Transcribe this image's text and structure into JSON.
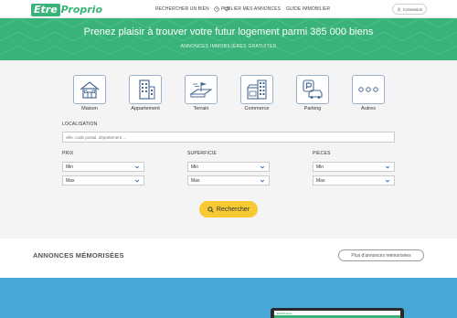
{
  "header": {
    "logo_part1": "Etre",
    "logo_part2": "Proprio",
    "nav_search": "RECHERCHER UN BIEN",
    "nav_publish": "PUBLIER MES ANNONCES",
    "nav_guide": "GUIDE IMMOBILIER",
    "login": "Connexion"
  },
  "hero": {
    "title": "Prenez plaisir à trouver votre futur logement parmi 385 000 biens",
    "subtitle": "ANNONCES IMMOBILIÈRES GRATUITES"
  },
  "property_types": [
    {
      "label": "Maison",
      "icon": "house-icon"
    },
    {
      "label": "Appartement",
      "icon": "apartment-building-icon"
    },
    {
      "label": "Terrain",
      "icon": "land-plot-icon"
    },
    {
      "label": "Commerce",
      "icon": "store-icon"
    },
    {
      "label": "Parking",
      "icon": "parking-icon"
    },
    {
      "label": "Autres",
      "icon": "more-dots-icon"
    }
  ],
  "location": {
    "label": "LOCALISATION",
    "placeholder": "ville, code postal, département ..."
  },
  "filters": {
    "price": {
      "label": "PRIX",
      "min": "Min",
      "max": "Max"
    },
    "surface": {
      "label": "SUPERFICIE",
      "min": "Min",
      "max": "Max"
    },
    "rooms": {
      "label": "PIECES",
      "min": "Min",
      "max": "Max"
    }
  },
  "search_button": "Rechercher",
  "memorised": {
    "title": "ANNONCES MÉMORISÉES",
    "more_button": "Plus d'annonces mémorisées"
  },
  "colors": {
    "brand_green": "#3ab37a",
    "accent_yellow": "#f7c933",
    "band_blue": "#47a7d6"
  }
}
